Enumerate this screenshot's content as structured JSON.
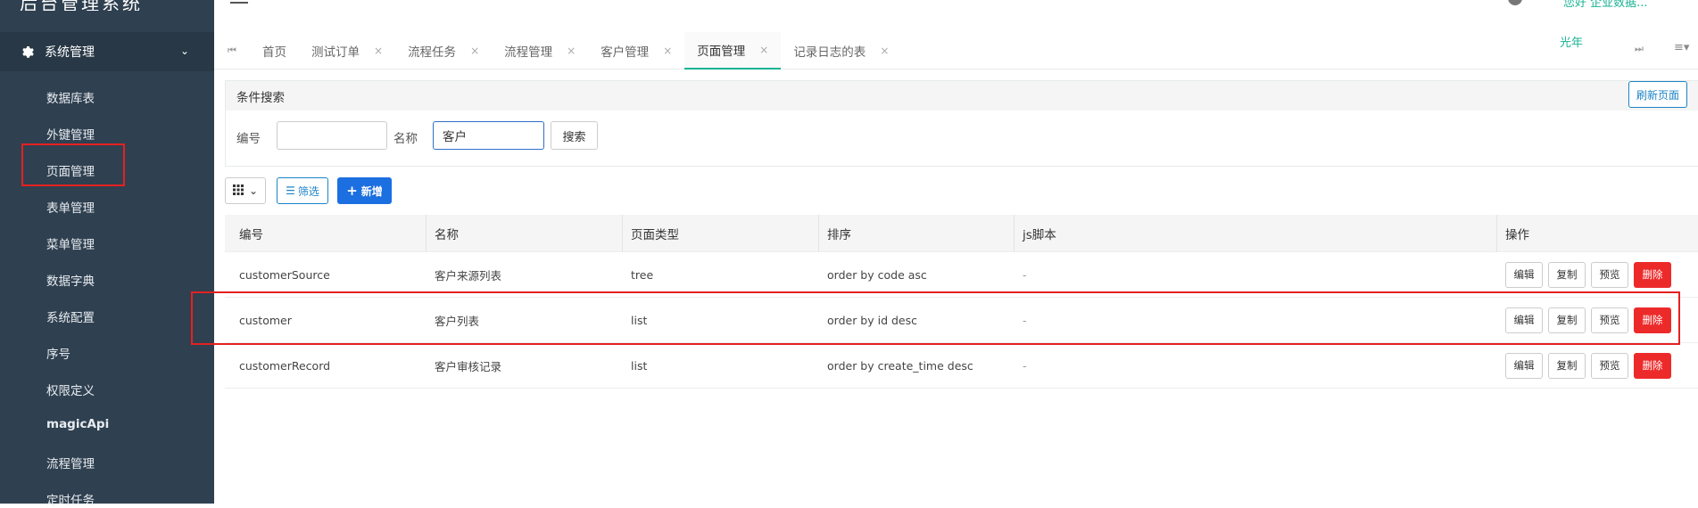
{
  "app": {
    "title": "后台管理系统"
  },
  "sidebar": {
    "group_label": "系统管理",
    "items": [
      {
        "label": "数据库表"
      },
      {
        "label": "外键管理"
      },
      {
        "label": "页面管理"
      },
      {
        "label": "表单管理"
      },
      {
        "label": "菜单管理"
      },
      {
        "label": "数据字典"
      },
      {
        "label": "系统配置"
      },
      {
        "label": "序号"
      },
      {
        "label": "权限定义"
      },
      {
        "label": "magicApi"
      },
      {
        "label": "流程管理"
      },
      {
        "label": "定时任务"
      }
    ]
  },
  "topbar": {
    "user_name": "光年",
    "top_right_text": "您好 企业数据..."
  },
  "tabs": [
    {
      "label": "首页",
      "closable": false
    },
    {
      "label": "测试订单",
      "closable": true
    },
    {
      "label": "流程任务",
      "closable": true
    },
    {
      "label": "流程管理",
      "closable": true
    },
    {
      "label": "客户管理",
      "closable": true
    },
    {
      "label": "页面管理",
      "closable": true,
      "active": true
    },
    {
      "label": "记录日志的表",
      "closable": true
    }
  ],
  "search": {
    "title": "条件搜索",
    "refresh_label": "刷新页面",
    "code_label": "编号",
    "code_value": "",
    "name_label": "名称",
    "name_value": "客户",
    "search_label": "搜索"
  },
  "toolbar": {
    "filter_label": "筛选",
    "add_label": "新增"
  },
  "table": {
    "columns": [
      "编号",
      "名称",
      "页面类型",
      "排序",
      "js脚本",
      "操作"
    ],
    "rows": [
      {
        "code": "customerSource",
        "name": "客户来源列表",
        "type": "tree",
        "order": "order by code asc",
        "js": "-"
      },
      {
        "code": "customer",
        "name": "客户列表",
        "type": "list",
        "order": "order by id desc",
        "js": "-"
      },
      {
        "code": "customerRecord",
        "name": "客户审核记录",
        "type": "list",
        "order": "order by create_time desc",
        "js": "-"
      }
    ],
    "actions": {
      "edit": "编辑",
      "copy": "复制",
      "preview": "预览",
      "delete": "删除"
    }
  },
  "colors": {
    "sidebar_bg": "#2f4050",
    "accent": "#1ab394",
    "primary": "#1c6fe0",
    "danger": "#ed2a2a",
    "highlight_box": "#e62020"
  }
}
